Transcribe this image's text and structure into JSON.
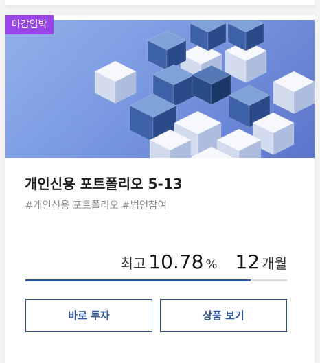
{
  "product": {
    "badge": "마감임박",
    "title": "개인신용 포트폴리오 5-13",
    "tags": "#개인신용 포트폴리오 #법인참여",
    "rate_label": "최고",
    "rate_value": "10.78",
    "rate_unit": "%",
    "term_value": "12",
    "term_unit": "개월",
    "funding_progress": 0.86,
    "invest_button": "바로 투자",
    "detail_button": "상품 보기"
  },
  "colors": {
    "badge": "#9a45e8",
    "accent": "#2d5599",
    "hero_bg": "#6c8ddd"
  }
}
